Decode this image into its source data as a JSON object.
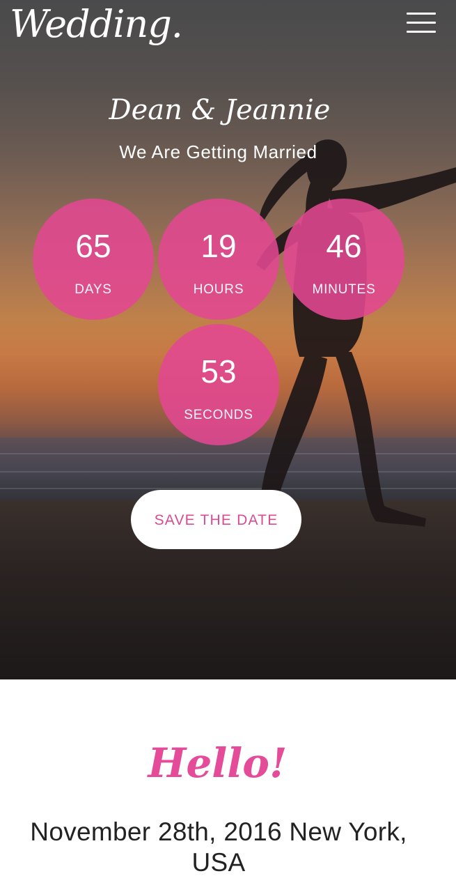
{
  "header": {
    "logo_text": "Wedding.",
    "menu_icon": "hamburger-menu-icon"
  },
  "hero": {
    "couple_names": "Dean & Jeannie",
    "tagline": "We Are Getting Married",
    "countdown": [
      {
        "value": "65",
        "label": "DAYS"
      },
      {
        "value": "19",
        "label": "HOURS"
      },
      {
        "value": "46",
        "label": "MINUTES"
      },
      {
        "value": "53",
        "label": "SECONDS"
      }
    ],
    "save_button_label": "SAVE THE DATE"
  },
  "intro": {
    "heading": "Hello!",
    "event_info": "November 28th, 2016 New York, USA"
  },
  "colors": {
    "accent": "#e44c9a",
    "circle_fill": "#e24892",
    "button_bg": "#ffffff",
    "text_dark": "#222222"
  }
}
